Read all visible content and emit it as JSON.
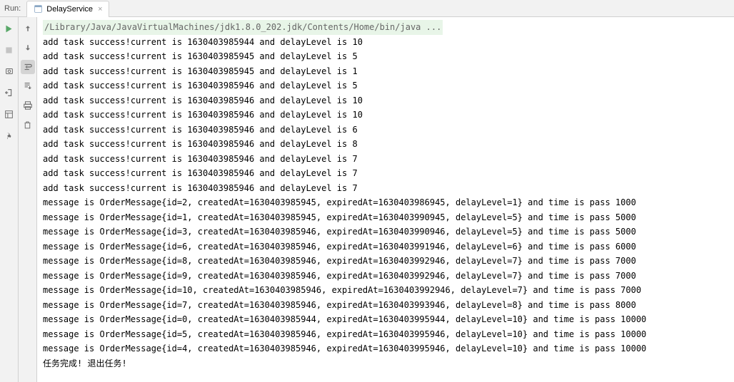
{
  "topbar": {
    "run_label": "Run:",
    "tab_label": "DelayService"
  },
  "console": {
    "command": "/Library/Java/JavaVirtualMachines/jdk1.8.0_202.jdk/Contents/Home/bin/java ...",
    "lines": [
      "add task success!current is 1630403985944 and delayLevel is 10",
      "add task success!current is 1630403985945 and delayLevel is 5",
      "add task success!current is 1630403985945 and delayLevel is 1",
      "add task success!current is 1630403985946 and delayLevel is 5",
      "add task success!current is 1630403985946 and delayLevel is 10",
      "add task success!current is 1630403985946 and delayLevel is 10",
      "add task success!current is 1630403985946 and delayLevel is 6",
      "add task success!current is 1630403985946 and delayLevel is 8",
      "add task success!current is 1630403985946 and delayLevel is 7",
      "add task success!current is 1630403985946 and delayLevel is 7",
      "add task success!current is 1630403985946 and delayLevel is 7",
      "message is OrderMessage{id=2, createdAt=1630403985945, expiredAt=1630403986945, delayLevel=1} and time is pass 1000",
      "message is OrderMessage{id=1, createdAt=1630403985945, expiredAt=1630403990945, delayLevel=5} and time is pass 5000",
      "message is OrderMessage{id=3, createdAt=1630403985946, expiredAt=1630403990946, delayLevel=5} and time is pass 5000",
      "message is OrderMessage{id=6, createdAt=1630403985946, expiredAt=1630403991946, delayLevel=6} and time is pass 6000",
      "message is OrderMessage{id=8, createdAt=1630403985946, expiredAt=1630403992946, delayLevel=7} and time is pass 7000",
      "message is OrderMessage{id=9, createdAt=1630403985946, expiredAt=1630403992946, delayLevel=7} and time is pass 7000",
      "message is OrderMessage{id=10, createdAt=1630403985946, expiredAt=1630403992946, delayLevel=7} and time is pass 7000",
      "message is OrderMessage{id=7, createdAt=1630403985946, expiredAt=1630403993946, delayLevel=8} and time is pass 8000",
      "message is OrderMessage{id=0, createdAt=1630403985944, expiredAt=1630403995944, delayLevel=10} and time is pass 10000",
      "message is OrderMessage{id=5, createdAt=1630403985946, expiredAt=1630403995946, delayLevel=10} and time is pass 10000",
      "message is OrderMessage{id=4, createdAt=1630403985946, expiredAt=1630403995946, delayLevel=10} and time is pass 10000",
      "任务完成! 退出任务!"
    ]
  }
}
